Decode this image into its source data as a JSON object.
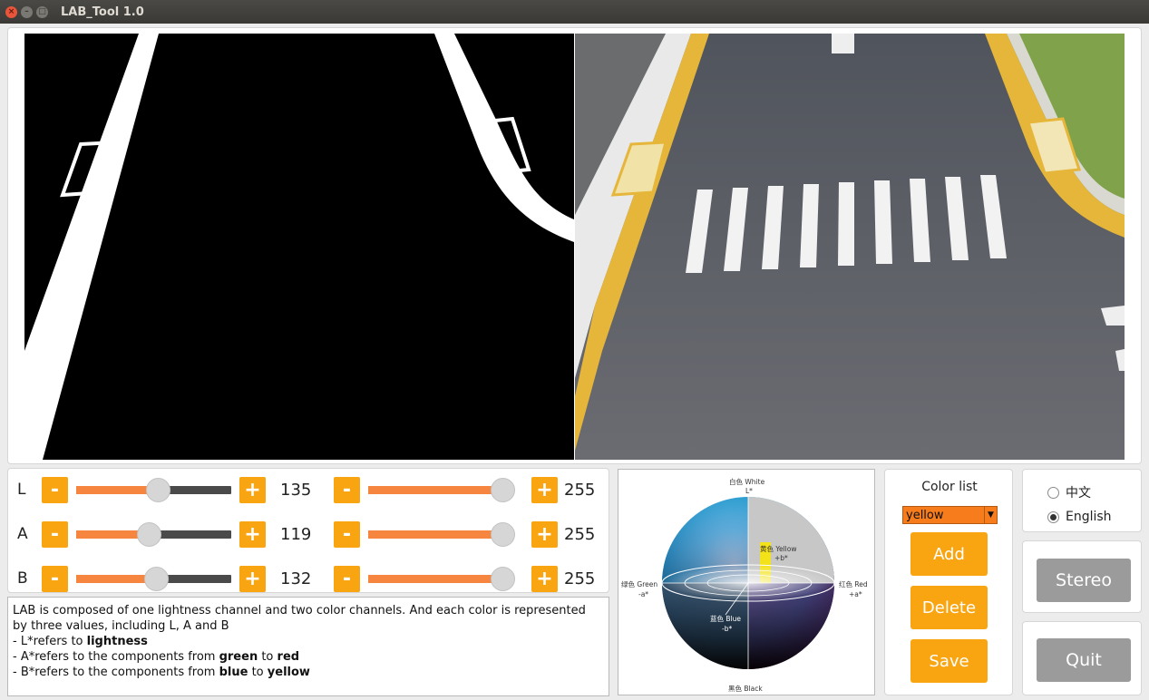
{
  "window": {
    "title": "LAB_Tool 1.0"
  },
  "sliders": [
    {
      "channel": "L",
      "min_value": 135,
      "max_value": 255,
      "min_level_pct": 53,
      "max_level_pct": 100
    },
    {
      "channel": "A",
      "min_value": 119,
      "max_value": 255,
      "min_level_pct": 47,
      "max_level_pct": 100
    },
    {
      "channel": "B",
      "min_value": 132,
      "max_value": 255,
      "min_level_pct": 52,
      "max_level_pct": 100
    }
  ],
  "controls": {
    "minus": "-",
    "plus": "+"
  },
  "description": {
    "line1": "LAB is composed of one lightness channel and two color channels. And each color is represented by three values, including L, A and B",
    "l_prefix": "- L*refers to ",
    "l_bold": "lightness",
    "a_prefix": "- A*refers to the components from ",
    "a_bold1": "green",
    "a_mid": " to ",
    "a_bold2": "red",
    "b_prefix": "- B*refers to the components from ",
    "b_bold1": "blue",
    "b_mid": " to ",
    "b_bold2": "yellow"
  },
  "sphere": {
    "white": "白色 White",
    "l_axis": "L*",
    "yellow": "黄色 Yellow",
    "plus_b": "+b*",
    "green": "绿色 Green",
    "minus_a": "-a*",
    "red": "红色 Red",
    "plus_a": "+a*",
    "blue": "蓝色 Blue",
    "minus_b": "-b*",
    "black": "黑色 Black"
  },
  "color_list": {
    "title": "Color list",
    "selected": "yellow",
    "add": "Add",
    "delete": "Delete",
    "save": "Save"
  },
  "language": {
    "options": [
      {
        "label": "中文",
        "selected": false
      },
      {
        "label": "English",
        "selected": true
      }
    ]
  },
  "actions": {
    "stereo": "Stereo",
    "quit": "Quit"
  },
  "colors": {
    "accent": "#f9a411",
    "slider_fill": "#f6853f",
    "disabled": "#9b9b9b"
  }
}
